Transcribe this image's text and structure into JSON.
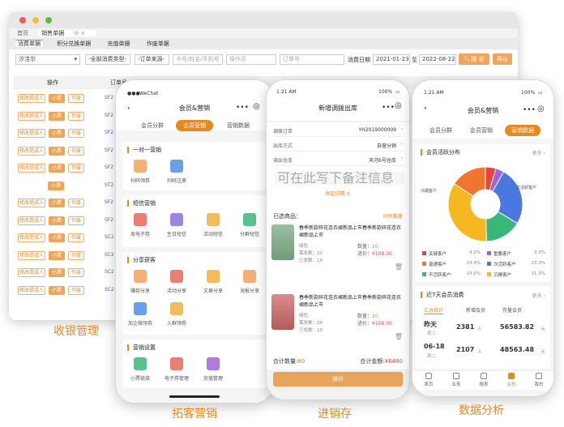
{
  "desktop": {
    "nav_tabs": [
      "首页",
      "销售单据"
    ],
    "sub_tabs": [
      "消费单据",
      "积分兑换单据",
      "充值单据",
      "作废单据"
    ],
    "filters": {
      "store": "汐洼尔",
      "consume_type": "-全部消费类型-",
      "order_source": "-订单来源-",
      "member_query_placeholder": "卡号/姓名/手机号",
      "operator_placeholder": "操作员",
      "order_no_placeholder": "订单号",
      "date_label": "消费日期",
      "date_from": "2021-01-23",
      "date_to": "2022-08-22",
      "search_button": "搜 索",
      "export_button": "导出"
    },
    "table": {
      "col_action": "操作",
      "col_order": "订单号",
      "rows": [
        {
          "actions": [
            "修改提成人",
            "小票",
            "作废"
          ],
          "code": "SF2"
        },
        {
          "actions": [
            "修改提成人",
            "小票",
            "作废"
          ],
          "code": "SF2"
        },
        {
          "actions": [
            "修改提成人",
            "小票",
            "作废"
          ],
          "code": "SF2"
        },
        {
          "actions": [
            "修改提成人",
            "小票",
            "作废"
          ],
          "code": "SF2"
        },
        {
          "actions": [
            "修改提成人",
            "小票",
            "作废"
          ],
          "code": "SF2"
        },
        {
          "actions": [
            "小票"
          ],
          "code": "ST2"
        },
        {
          "actions": [
            "修改提成人",
            "小票",
            "作废"
          ],
          "code": "SF2"
        },
        {
          "actions": [
            "修改提成人",
            "小票",
            "作废"
          ],
          "code": "SF2"
        },
        {
          "actions": [
            "修改提成人",
            "小票",
            "作废"
          ],
          "code": "SC2"
        },
        {
          "actions": [
            "修改提成人",
            "小票",
            "作废"
          ],
          "code": "SC2"
        },
        {
          "actions": [
            "修改提成人",
            "小票",
            "作废"
          ],
          "code": "SC2"
        },
        {
          "actions": [
            "修改提成人",
            "小票",
            "作废"
          ],
          "code": "SC2"
        }
      ]
    },
    "caption": "收银管理"
  },
  "phone1": {
    "carrier": "WeChat",
    "title": "会员&营销",
    "tabs": [
      "会员分群",
      "会员营销",
      "营销数据"
    ],
    "active_tab": 1,
    "sections": [
      {
        "title": "一对一营销",
        "items": [
          {
            "label": "扫码领券",
            "icon": "coupon-icon"
          },
          {
            "label": "扫码注册",
            "icon": "register-icon"
          }
        ]
      },
      {
        "title": "短信营销",
        "items": [
          {
            "label": "发电子券",
            "icon": "ticket-icon"
          },
          {
            "label": "生日短信",
            "icon": "cake-icon"
          },
          {
            "label": "活动短信",
            "icon": "message-icon"
          },
          {
            "label": "分群短信",
            "icon": "group-icon"
          }
        ]
      },
      {
        "title": "分享获客",
        "items": [
          {
            "label": "赚款分享",
            "icon": "money-icon"
          },
          {
            "label": "活动分享",
            "icon": "share-icon"
          },
          {
            "label": "文章分享",
            "icon": "article-icon"
          },
          {
            "label": "海报分享",
            "icon": "poster-icon"
          },
          {
            "label": "加企微领券",
            "icon": "wecom-icon"
          },
          {
            "label": "入群领券",
            "icon": "group-coupon-icon"
          }
        ]
      },
      {
        "title": "营销设置",
        "items": [
          {
            "label": "小票链接",
            "icon": "receipt-icon"
          },
          {
            "label": "电子券管理",
            "icon": "coupon-manage-icon"
          },
          {
            "label": "充值管理",
            "icon": "recharge-icon"
          }
        ]
      }
    ],
    "caption": "拓客营销"
  },
  "phone2": {
    "time": "1:21 AM",
    "battery": "100%",
    "title": "新增调拨出库",
    "fields": [
      {
        "label": "调拨订单",
        "value": "YH2019000009"
      },
      {
        "label": "出库方式",
        "value": "自营分销"
      },
      {
        "label": "调出仓库",
        "value": "天河6号仓库"
      }
    ],
    "remark_placeholder": "可在此写下备注信息",
    "collapse_label": "收起详情",
    "goods_header": "已选商品：",
    "sync_label": "同步数量",
    "goods": [
      {
        "name": "春季新款碎花连衣裙新品上市春季新款碎花连衣裙新品上市",
        "color": "绿色",
        "qty_label": "数量：",
        "qty": "20",
        "need": "需发数：20",
        "price_label": "进价：",
        "price": "¥108.00",
        "sent": "已发数：10"
      },
      {
        "name": "春季新款碎花连衣裙新品上市春季新款碎花连衣裙新品上市",
        "color": "绿色",
        "qty_label": "数量：",
        "qty": "20",
        "need": "需发数：20",
        "price_label": "进价：",
        "price": "¥108.00",
        "sent": "已发数：10"
      }
    ],
    "total_qty_label": "合计数量:",
    "total_qty": "60",
    "total_amount_label": "合计金额:",
    "total_amount": "¥6480",
    "save_button": "保存",
    "caption": "进销存"
  },
  "phone3": {
    "time": "1:21 AM",
    "battery": "100%",
    "title": "会员&营销",
    "tabs": [
      "会员分群",
      "会员营销",
      "营销数据"
    ],
    "active_tab": 2,
    "dist_title": "会员活跃分布",
    "more": "更多",
    "legend": [
      {
        "name": "关键客户",
        "pct": "4.2%",
        "color": "#e8443a"
      },
      {
        "name": "重要客户",
        "pct": "3.3%",
        "color": "#a461d8"
      },
      {
        "name": "普通客户",
        "pct": "14.4%",
        "color": "#f1742f"
      },
      {
        "name": "次活跃客户",
        "pct": "23.3%",
        "color": "#4b78e0"
      },
      {
        "name": "不活跃客户",
        "pct": "14.6%",
        "color": "#3ab776"
      },
      {
        "name": "沉睡客户",
        "pct": "31.9%",
        "color": "#f5b822"
      }
    ],
    "pie_labels": [
      "次活跃客户",
      "沉睡客户"
    ],
    "consume_title": "近7天会员消费",
    "sub_tabs": [
      "汇总统计",
      "新增会员",
      "存量会员"
    ],
    "stats": [
      {
        "date": "昨天",
        "weekday": "周三",
        "count": "2381",
        "unit": "人",
        "amount": "56583.82",
        "unit2": "元"
      },
      {
        "date": "06-18",
        "weekday": "周二",
        "count": "2107",
        "unit": "人",
        "amount": "48563.48",
        "unit2": "元"
      }
    ],
    "bottom_nav": [
      "首页",
      "业务",
      "报表",
      "会员",
      "我的"
    ],
    "caption": "数据分析"
  }
}
